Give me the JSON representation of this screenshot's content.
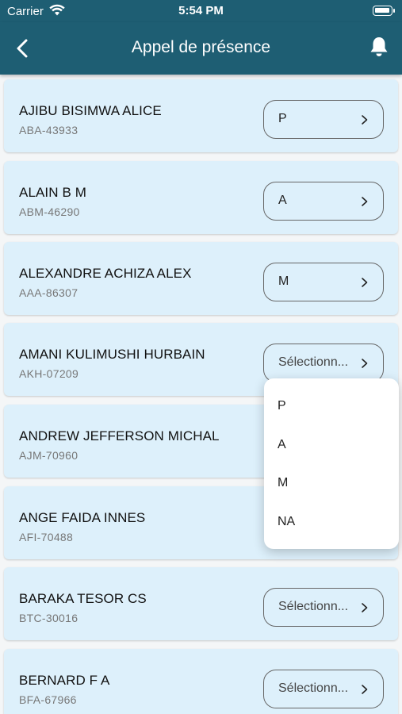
{
  "status_bar": {
    "carrier": "Carrier",
    "time": "5:54 PM"
  },
  "nav": {
    "title": "Appel de présence",
    "back_icon": "chevron-left-icon",
    "bell_icon": "bell-icon"
  },
  "students": [
    {
      "name": "AJIBU BISIMWA ALICE",
      "code": "ABA-43933",
      "status": "P"
    },
    {
      "name": "ALAIN B M",
      "code": "ABM-46290",
      "status": "A"
    },
    {
      "name": "ALEXANDRE ACHIZA ALEX",
      "code": "AAA-86307",
      "status": "M"
    },
    {
      "name": "AMANI KULIMUSHI HURBAIN",
      "code": "AKH-07209",
      "status": "Sélectionn..."
    },
    {
      "name": "ANDREW JEFFERSON MICHAL",
      "code": "AJM-70960",
      "status": ""
    },
    {
      "name": "ANGE FAIDA INNES",
      "code": "AFI-70488",
      "status": ""
    },
    {
      "name": "BARAKA TESOR CS",
      "code": "BTC-30016",
      "status": "Sélectionn..."
    },
    {
      "name": "BERNARD F A",
      "code": "BFA-67966",
      "status": "Sélectionn..."
    }
  ],
  "dropdown": {
    "options": [
      "P",
      "A",
      "M",
      "NA"
    ]
  },
  "colors": {
    "header": "#1e5e73",
    "card": "#ddf0fb"
  }
}
